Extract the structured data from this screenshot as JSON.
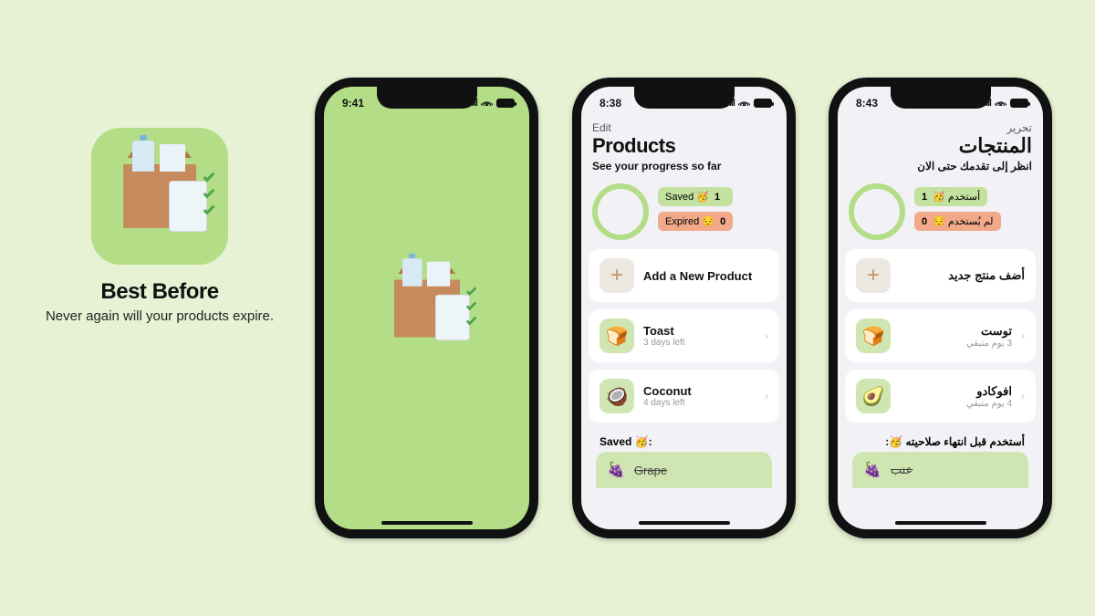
{
  "promo": {
    "title": "Best Before",
    "tagline": "Never again will your products expire."
  },
  "splash": {
    "time": "9:41"
  },
  "en": {
    "time": "8:38",
    "edit_label": "Edit",
    "title": "Products",
    "subtitle": "See your progress so far",
    "saved_pill_label": "Saved 🥳",
    "saved_pill_count": "1",
    "expired_pill_label": "Expired 😔",
    "expired_pill_count": "0",
    "add_label": "Add a New Product",
    "items": [
      {
        "emoji": "🍞",
        "name": "Toast",
        "sub": "3 days left"
      },
      {
        "emoji": "🥥",
        "name": "Coconut",
        "sub": "4 days left"
      }
    ],
    "saved_section_label": "Saved 🥳:",
    "saved_item": {
      "emoji": "🍇",
      "name": "Grape"
    }
  },
  "ar": {
    "time": "8:43",
    "edit_label": "تحرير",
    "title": "المنتجات",
    "subtitle": "انظر إلى تقدمك حتى الان",
    "saved_pill_label": "أستخدم 🥳",
    "saved_pill_count": "1",
    "expired_pill_label": "لم يُستخدم 😔",
    "expired_pill_count": "0",
    "add_label": "أضف منتج جديد",
    "items": [
      {
        "emoji": "🍞",
        "name": "توست",
        "sub": "3 يوم متبقي"
      },
      {
        "emoji": "🥑",
        "name": "افوكادو",
        "sub": "4 يوم متبقي"
      }
    ],
    "saved_section_label": "أستخدم قبل انتهاء صلاحيته 🥳:",
    "saved_item": {
      "emoji": "🍇",
      "name": "عنب"
    }
  }
}
